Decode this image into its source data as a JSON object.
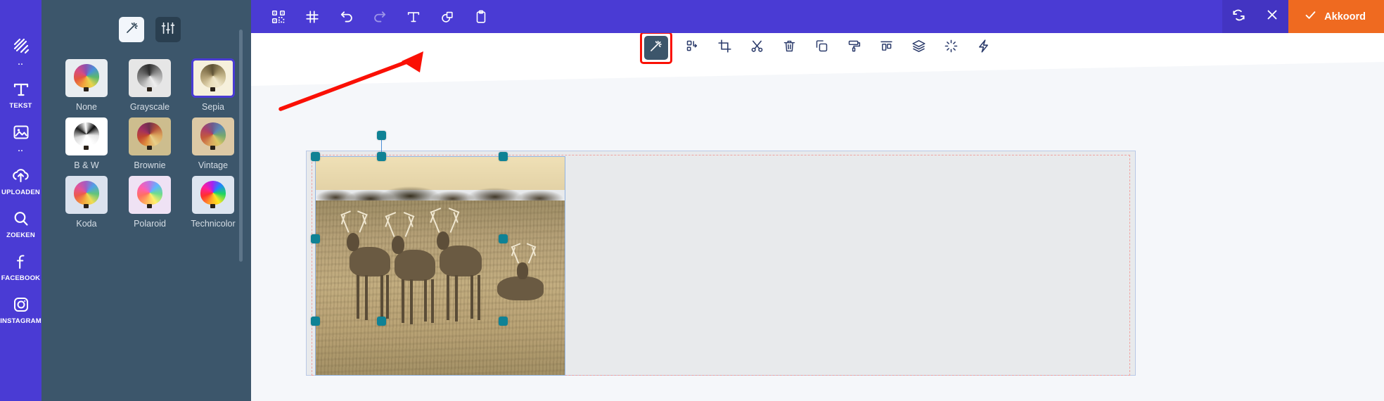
{
  "app": {
    "accent_purple": "#4a3bd4",
    "panel_slate": "#3c566b",
    "accept_orange": "#ef6a20",
    "handle_teal": "#0f8295",
    "highlight_red": "#fa1005"
  },
  "nav_rail": {
    "items": [
      {
        "label": "..",
        "icon": "hatch-lines-icon",
        "name": "sidebar-item-background"
      },
      {
        "label": "TEKST",
        "icon": "text-t-icon",
        "name": "sidebar-item-tekst"
      },
      {
        "label": "..",
        "icon": "image-icon",
        "name": "sidebar-item-afbeelding"
      },
      {
        "label": "UPLOADEN",
        "icon": "upload-cloud-icon",
        "name": "sidebar-item-uploaden"
      },
      {
        "label": "ZOEKEN",
        "icon": "search-icon",
        "name": "sidebar-item-zoeken"
      },
      {
        "label": "FACEBOOK",
        "icon": "facebook-icon",
        "name": "sidebar-item-facebook"
      },
      {
        "label": "INSTAGRAM",
        "icon": "instagram-icon",
        "name": "sidebar-item-instagram"
      }
    ]
  },
  "filter_panel": {
    "modes": [
      {
        "label": "Filters",
        "icon": "magic-wand-icon",
        "active": true
      },
      {
        "label": "Aanpassen",
        "icon": "sliders-icon",
        "active": false
      }
    ],
    "filters": [
      {
        "label": "None",
        "selected": false,
        "env": "conic-gradient(from 200deg, #f2a33c, #e3573f, #d64b84, #8e4fae, #4a90d9, #5bb86f, #e8d44d, #f2a33c)",
        "bg": "#e9edf1"
      },
      {
        "label": "Grayscale",
        "selected": false,
        "env": "conic-gradient(from 200deg, #cfcfcf, #8e8e8e, #5a5a5a, #2d2d2d, #777777, #b5b5b5, #efefef, #cfcfcf)",
        "bg": "#e6e6e6"
      },
      {
        "label": "Sepia",
        "selected": true,
        "env": "conic-gradient(from 200deg, #e8dcb8, #bba97e, #8d7c55, #5d5134, #9a8a60, #cbbd92, #f1e8cc, #e8dcb8)",
        "bg": "#f6f0dc"
      },
      {
        "label": "B & W",
        "selected": false,
        "env": "conic-gradient(from 200deg, #ffffff, #d8d8d8, #1c1c1c, #ffffff, #111111, #e8e8e8, #ffffff, #ffffff)",
        "bg": "#ffffff"
      },
      {
        "label": "Brownie",
        "selected": false,
        "env": "conic-gradient(from 200deg, #e0923f, #c2472f, #a13060, #6e2f4e, #b4523a, #dba45c, #e8cf8a, #e0923f)",
        "bg": "#cdbd8e"
      },
      {
        "label": "Vintage",
        "selected": false,
        "env": "conic-gradient(from 200deg, #d9a05a, #c35a3c, #ab3f6a, #6f5a8c, #5c87b5, #74a86e, #ddc766, #d9a05a)",
        "bg": "#ddc9a5"
      },
      {
        "label": "Koda",
        "selected": false,
        "env": "conic-gradient(from 200deg, #f2a33c, #ec5a4a, #e3529a, #a55cc0, #4fa0e8, #62c47b, #f0dd55, #f2a33c)",
        "bg": "#dbe2ee"
      },
      {
        "label": "Polaroid",
        "selected": false,
        "env": "conic-gradient(from 200deg, #ffb35c, #ff6f62, #ff5fb0, #c071e0, #5fb6ff, #6fdc8c, #ffef6b, #ffb35c)",
        "bg": "#efe2f4"
      },
      {
        "label": "Technicolor",
        "selected": false,
        "env": "conic-gradient(from 200deg, #ff9e28, #ff2f2f, #ff1f9b, #a621ef, #1f86ff, #1fd65e, #ffe81f, #ff9e28)",
        "bg": "#dde5f0"
      }
    ]
  },
  "header": {
    "tools": [
      {
        "name": "qr-code-icon",
        "label": "QR-code",
        "dim": false
      },
      {
        "name": "grid-icon",
        "label": "Raster",
        "dim": false
      },
      {
        "name": "undo-icon",
        "label": "Ongedaan maken",
        "dim": false
      },
      {
        "name": "redo-icon",
        "label": "Opnieuw",
        "dim": true
      },
      {
        "name": "text-t-icon",
        "label": "Tekst",
        "dim": false
      },
      {
        "name": "shape-icon",
        "label": "Vorm",
        "dim": false
      },
      {
        "name": "clipboard-icon",
        "label": "Klembord",
        "dim": false
      }
    ],
    "reset_label": "Resetten",
    "close_label": "Sluiten",
    "accept_label": "Akkoord"
  },
  "subbar": {
    "tools": [
      {
        "name": "magic-wand-icon",
        "label": "Filters",
        "selected": true,
        "highlighted": true
      },
      {
        "name": "arrange-icon",
        "label": "Rangschikken",
        "selected": false,
        "highlighted": false
      },
      {
        "name": "crop-icon",
        "label": "Bijsnijden",
        "selected": false,
        "highlighted": false
      },
      {
        "name": "scissors-icon",
        "label": "Knippen",
        "selected": false,
        "highlighted": false
      },
      {
        "name": "trash-icon",
        "label": "Verwijderen",
        "selected": false,
        "highlighted": false
      },
      {
        "name": "duplicate-icon",
        "label": "Dupliceren",
        "selected": false,
        "highlighted": false
      },
      {
        "name": "paint-roller-icon",
        "label": "Kleur",
        "selected": false,
        "highlighted": false
      },
      {
        "name": "align-icon",
        "label": "Uitlijnen",
        "selected": false,
        "highlighted": false
      },
      {
        "name": "layers-icon",
        "label": "Lagen",
        "selected": false,
        "highlighted": false
      },
      {
        "name": "brightness-icon",
        "label": "Helderheid",
        "selected": false,
        "highlighted": false
      },
      {
        "name": "bolt-icon",
        "label": "Effecten",
        "selected": false,
        "highlighted": false
      }
    ]
  },
  "canvas": {
    "selected_object": "photo-deer-herd",
    "photo_alt": "Sepia foto van een kudde herten in een veld"
  }
}
